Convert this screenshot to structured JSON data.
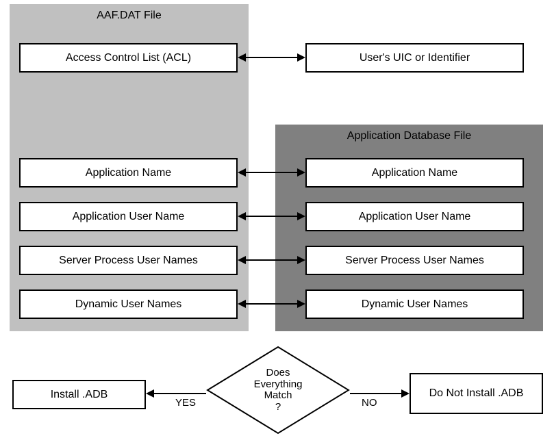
{
  "containers": {
    "aaf_title": "AAF.DAT File",
    "adb_title": "Application Database File"
  },
  "aaf": {
    "acl": "Access Control List (ACL)",
    "app_name": "Application Name",
    "app_user": "Application User Name",
    "server_proc": "Server Process User  Names",
    "dynamic": "Dynamic User Names"
  },
  "right": {
    "uic": "User's UIC or Identifier",
    "app_name": "Application Name",
    "app_user": "Application User Name",
    "server_proc": "Server Process User  Names",
    "dynamic": "Dynamic User Names"
  },
  "decision": {
    "line1": "Does",
    "line2": "Everything",
    "line3": "Match",
    "line4": "?",
    "yes_label": "YES",
    "no_label": "NO"
  },
  "outcomes": {
    "install": "Install  .ADB",
    "no_install": "Do Not Install .ADB"
  }
}
